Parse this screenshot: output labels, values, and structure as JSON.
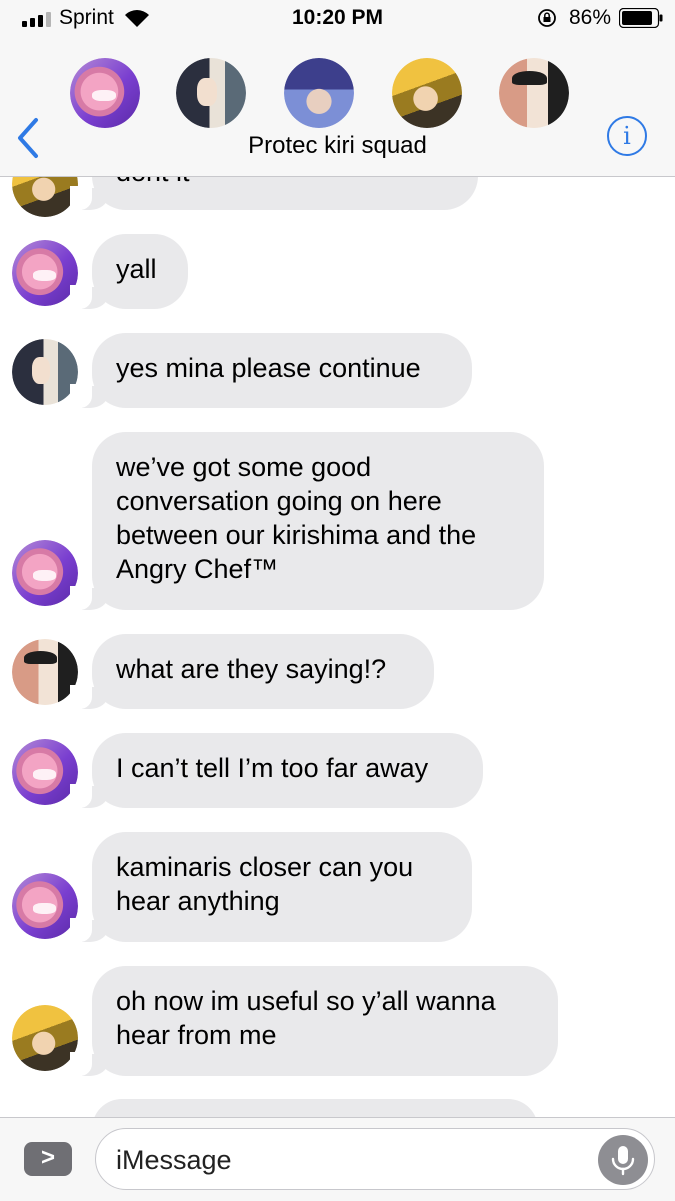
{
  "status_bar": {
    "carrier": "Sprint",
    "time": "10:20 PM",
    "battery": "86%"
  },
  "header": {
    "group_name": "Protec kiri squad",
    "info_label": "i",
    "icons": [
      "chevron-left-icon",
      "info-icon"
    ]
  },
  "thread": {
    "messages": [
      {
        "sender": "kaminari",
        "text": "dont it"
      },
      {
        "sender": "mina",
        "text": "yall"
      },
      {
        "sender": "jiro",
        "text": "yes mina please continue"
      },
      {
        "sender": "mina",
        "text": "we’ve got some good conversation going on here between our kirishima and the Angry Chef™"
      },
      {
        "sender": "sero",
        "text": "what are they saying!?"
      },
      {
        "sender": "mina",
        "text": "I can’t tell I’m too far away"
      },
      {
        "sender": "mina",
        "text": "kaminaris closer can you hear anything"
      },
      {
        "sender": "kaminari",
        "text": "oh now im useful so y’all wanna hear from me"
      },
      {
        "sender": "unknown",
        "text": ""
      }
    ]
  },
  "compose": {
    "apps_label": ">",
    "placeholder": "iMessage"
  },
  "colors": {
    "accent": "#2f7ae5",
    "bubble": "#e9e9eb",
    "bar": "#f7f7f7"
  }
}
